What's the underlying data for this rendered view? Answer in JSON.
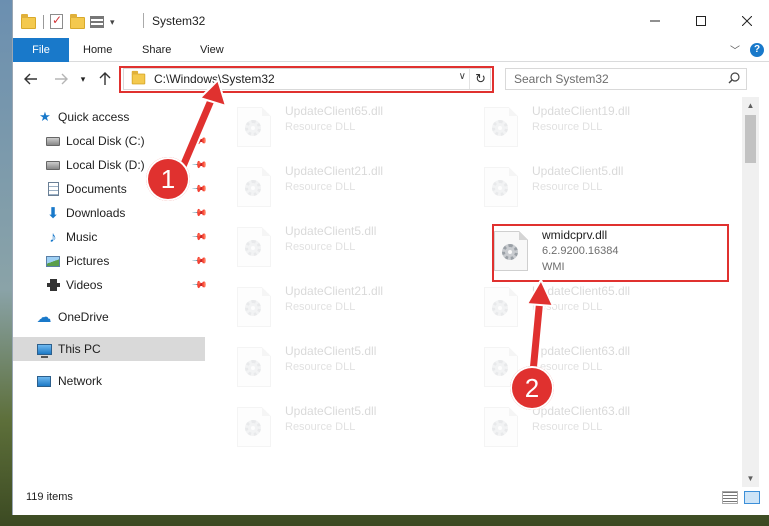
{
  "window": {
    "title": "System32",
    "controls": {
      "minimize": "minimize",
      "maximize": "maximize",
      "close": "close"
    }
  },
  "ribbon": {
    "tabs": [
      {
        "label": "File"
      },
      {
        "label": "Home"
      },
      {
        "label": "Share"
      },
      {
        "label": "View"
      }
    ]
  },
  "address_bar": {
    "path": "C:\\Windows\\System32",
    "search_placeholder": "Search System32"
  },
  "sidebar": {
    "quick_access": "Quick access",
    "items": [
      {
        "label": "Local Disk (C:)",
        "icon": "drive-icon",
        "pinned": true
      },
      {
        "label": "Local Disk (D:)",
        "icon": "drive-icon",
        "pinned": true
      },
      {
        "label": "Documents",
        "icon": "documents-icon",
        "pinned": true
      },
      {
        "label": "Downloads",
        "icon": "downloads-icon",
        "pinned": true
      },
      {
        "label": "Music",
        "icon": "music-icon",
        "pinned": true
      },
      {
        "label": "Pictures",
        "icon": "pictures-icon",
        "pinned": true
      },
      {
        "label": "Videos",
        "icon": "videos-icon",
        "pinned": true
      }
    ],
    "onedrive": "OneDrive",
    "this_pc": "This PC",
    "network": "Network"
  },
  "files": [
    {
      "name": "UpdateClient65.dll",
      "type": "Resource DLL",
      "extra": "",
      "faded": true
    },
    {
      "name": "UpdateClient19.dll",
      "type": "Resource DLL",
      "extra": "",
      "faded": true
    },
    {
      "name": "UpdateClient21.dll",
      "type": "Resource DLL",
      "extra": "",
      "faded": true
    },
    {
      "name": "UpdateClient5.dll",
      "type": "Resource DLL",
      "extra": "",
      "faded": true
    },
    {
      "name": "UpdateClient5.dll",
      "type": "Resource DLL",
      "extra": "",
      "faded": true
    },
    {
      "name": "wmidcprv.dll",
      "type": "6.2.9200.16384",
      "extra": "WMI",
      "faded": false
    },
    {
      "name": "UpdateClient21.dll",
      "type": "Resource DLL",
      "extra": "",
      "faded": true
    },
    {
      "name": "UpdateClient65.dll",
      "type": "Resource DLL",
      "extra": "",
      "faded": true
    },
    {
      "name": "UpdateClient5.dll",
      "type": "Resource DLL",
      "extra": "",
      "faded": true
    },
    {
      "name": "UpdateClient63.dll",
      "type": "Resource DLL",
      "extra": "",
      "faded": true
    },
    {
      "name": "UpdateClient5.dll",
      "type": "Resource DLL",
      "extra": "",
      "faded": true
    },
    {
      "name": "UpdateClient63.dll",
      "type": "Resource DLL",
      "extra": "",
      "faded": true
    }
  ],
  "status": {
    "item_count": "119 items"
  },
  "callouts": [
    {
      "label": "1"
    },
    {
      "label": "2"
    }
  ],
  "colors": {
    "accent": "#1979ca",
    "callout": "#e0312f"
  }
}
